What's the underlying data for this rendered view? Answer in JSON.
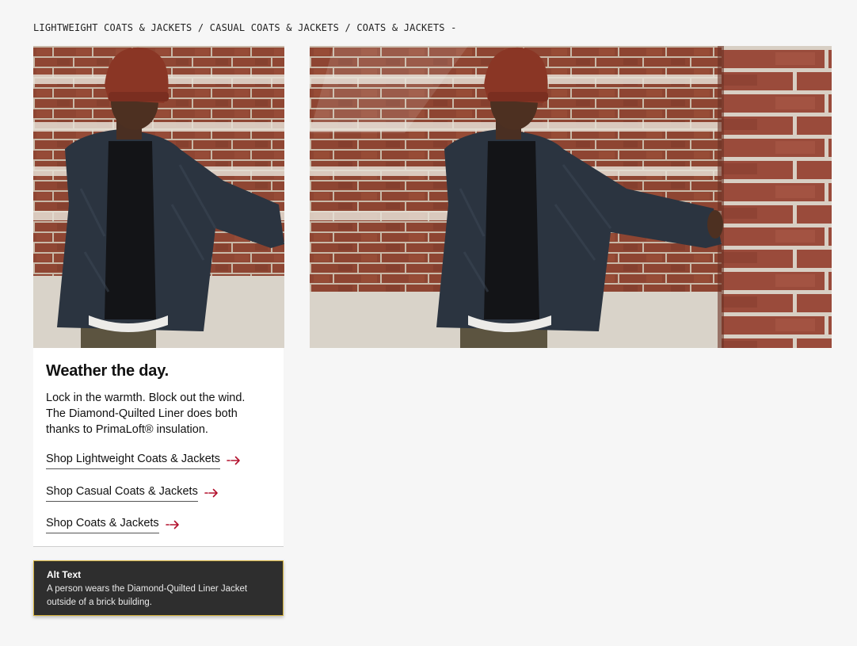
{
  "breadcrumb": {
    "text": "LIGHTWEIGHT COATS & JACKETS / CASUAL COATS & JACKETS / COATS & JACKETS -"
  },
  "images": {
    "left": {
      "icon": "photo-person-brick-wall"
    },
    "right": {
      "icon": "photo-person-brick-wall-wide"
    }
  },
  "card": {
    "headline": "Weather the day.",
    "body": "Lock in the warmth. Block out the wind. The Diamond-Quilted Liner does both thanks to PrimaLoft® insulation.",
    "links": [
      {
        "label": "Shop Lightweight Coats & Jackets"
      },
      {
        "label": "Shop Casual Coats & Jackets"
      },
      {
        "label": "Shop Coats & Jackets"
      }
    ],
    "arrow_icon": "arrow-right-icon",
    "accent_color": "#b3122e"
  },
  "alt_text": {
    "title": "Alt Text",
    "description": "A person wears the Diamond-Quilted Liner Jacket outside of a brick building."
  }
}
